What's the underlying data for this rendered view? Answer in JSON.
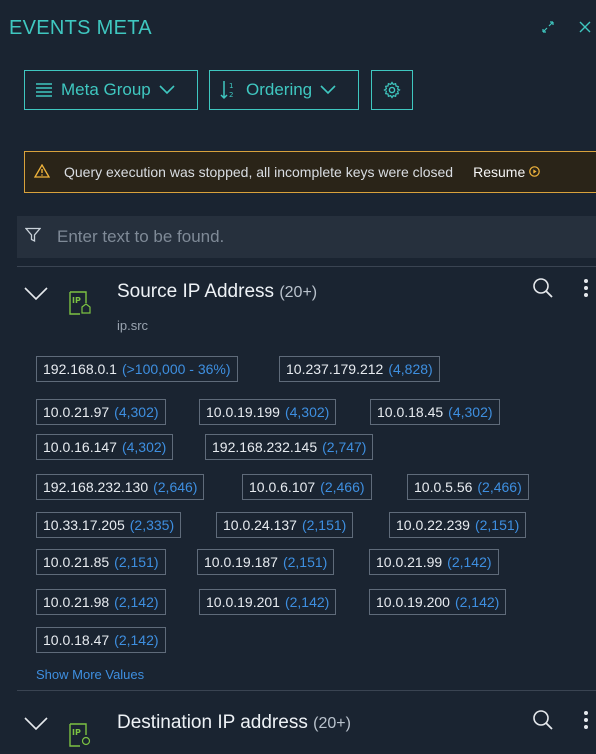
{
  "header": {
    "title": "EVENTS META",
    "expand_icon": "expand-icon",
    "close_icon": "close-icon"
  },
  "toolbar": {
    "meta_group_label": "Meta Group",
    "ordering_label": "Ordering",
    "settings_icon": "gear-icon"
  },
  "warning": {
    "message": "Query execution was stopped, all incomplete keys were closed",
    "resume_label": "Resume"
  },
  "filter": {
    "placeholder": "Enter text to be found.",
    "value": ""
  },
  "sections": [
    {
      "title": "Source IP Address",
      "count": "(20+)",
      "key": "ip.src",
      "values": [
        {
          "value": "192.168.0.1",
          "count": "(>100,000 - 36%)"
        },
        {
          "value": "10.237.179.212",
          "count": "(4,828)"
        },
        {
          "value": "10.0.21.97",
          "count": "(4,302)"
        },
        {
          "value": "10.0.19.199",
          "count": "(4,302)"
        },
        {
          "value": "10.0.18.45",
          "count": "(4,302)"
        },
        {
          "value": "10.0.16.147",
          "count": "(4,302)"
        },
        {
          "value": "192.168.232.145",
          "count": "(2,747)"
        },
        {
          "value": "192.168.232.130",
          "count": "(2,646)"
        },
        {
          "value": "10.0.6.107",
          "count": "(2,466)"
        },
        {
          "value": "10.0.5.56",
          "count": "(2,466)"
        },
        {
          "value": "10.33.17.205",
          "count": "(2,335)"
        },
        {
          "value": "10.0.24.137",
          "count": "(2,151)"
        },
        {
          "value": "10.0.22.239",
          "count": "(2,151)"
        },
        {
          "value": "10.0.21.85",
          "count": "(2,151)"
        },
        {
          "value": "10.0.19.187",
          "count": "(2,151)"
        },
        {
          "value": "10.0.21.99",
          "count": "(2,142)"
        },
        {
          "value": "10.0.21.98",
          "count": "(2,142)"
        },
        {
          "value": "10.0.19.201",
          "count": "(2,142)"
        },
        {
          "value": "10.0.19.200",
          "count": "(2,142)"
        },
        {
          "value": "10.0.18.47",
          "count": "(2,142)"
        }
      ],
      "show_more_label": "Show More Values"
    },
    {
      "title": "Destination IP address",
      "count": "(20+)"
    }
  ],
  "colors": {
    "accent": "#3fc7c0",
    "background": "#1a2431",
    "warning_border": "#d8a23c",
    "count_blue": "#3e8fe0",
    "ip_icon_green": "#7cc242"
  }
}
